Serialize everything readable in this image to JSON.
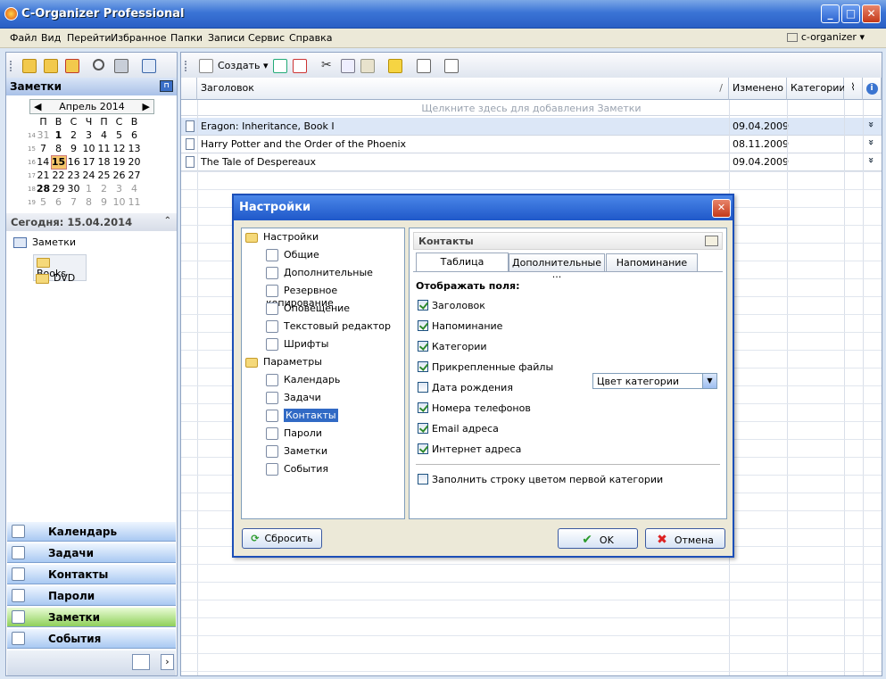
{
  "window": {
    "title": "C-Organizer Professional"
  },
  "menu": {
    "items": [
      "Файл",
      "Вид",
      "Перейти",
      "Избранное",
      "Папки",
      "Записи",
      "Сервис",
      "Справка"
    ],
    "profile": "c-organizer"
  },
  "toolbar": {
    "create_label": "Создать"
  },
  "left": {
    "header": "Заметки",
    "calendar": {
      "month": "Апрель 2014",
      "weekdays": [
        "П",
        "В",
        "С",
        "Ч",
        "П",
        "С",
        "В"
      ],
      "weeks": [
        {
          "num": "14",
          "days": [
            "31",
            "1",
            "2",
            "3",
            "4",
            "5",
            "6"
          ]
        },
        {
          "num": "15",
          "days": [
            "7",
            "8",
            "9",
            "10",
            "11",
            "12",
            "13"
          ]
        },
        {
          "num": "16",
          "days": [
            "14",
            "15",
            "16",
            "17",
            "18",
            "19",
            "20"
          ]
        },
        {
          "num": "17",
          "days": [
            "21",
            "22",
            "23",
            "24",
            "25",
            "26",
            "27"
          ]
        },
        {
          "num": "18",
          "days": [
            "28",
            "29",
            "30",
            "1",
            "2",
            "3",
            "4"
          ]
        },
        {
          "num": "19",
          "days": [
            "5",
            "6",
            "7",
            "8",
            "9",
            "10",
            "11"
          ]
        }
      ]
    },
    "today": "Сегодня: 15.04.2014",
    "tree": {
      "root": "Заметки",
      "children": [
        "Books",
        "DVD"
      ]
    },
    "nav": [
      "Календарь",
      "Задачи",
      "Контакты",
      "Пароли",
      "Заметки",
      "События"
    ]
  },
  "grid": {
    "columns": {
      "title": "Заголовок",
      "modified": "Изменено",
      "categories": "Категории"
    },
    "add_hint": "Щелкните здесь для добавления Заметки",
    "rows": [
      {
        "title": "Eragon: Inheritance, Book I",
        "modified": "09.04.2009"
      },
      {
        "title": "Harry Potter and the Order of the Phoenix",
        "modified": "08.11.2009"
      },
      {
        "title": "The Tale of Despereaux",
        "modified": "09.04.2009"
      }
    ]
  },
  "dialog": {
    "title": "Настройки",
    "tree": {
      "group1": "Настройки",
      "items1": [
        "Общие",
        "Дополнительные",
        "Резервное копирование",
        "Оповещение",
        "Текстовый редактор",
        "Шрифты"
      ],
      "group2": "Параметры",
      "items2": [
        "Календарь",
        "Задачи",
        "Контакты",
        "Пароли",
        "Заметки",
        "События"
      ]
    },
    "pane_title": "Контакты",
    "tabs": [
      "Таблица",
      "Дополнительные ...",
      "Напоминание"
    ],
    "fields_label": "Отображать поля:",
    "fields": [
      {
        "label": "Заголовок",
        "checked": true
      },
      {
        "label": "Напоминание",
        "checked": true
      },
      {
        "label": "Категории",
        "checked": true
      },
      {
        "label": "Прикрепленные файлы",
        "checked": true
      },
      {
        "label": "Дата рождения",
        "checked": false
      },
      {
        "label": "Номера телефонов",
        "checked": true
      },
      {
        "label": "Email адреса",
        "checked": true
      },
      {
        "label": "Интернет адреса",
        "checked": true
      }
    ],
    "category_select": "Цвет категории",
    "fill_row": {
      "label": "Заполнить строку цветом первой категории",
      "checked": false
    },
    "reset": "Сбросить",
    "ok": "OK",
    "cancel": "Отмена"
  }
}
